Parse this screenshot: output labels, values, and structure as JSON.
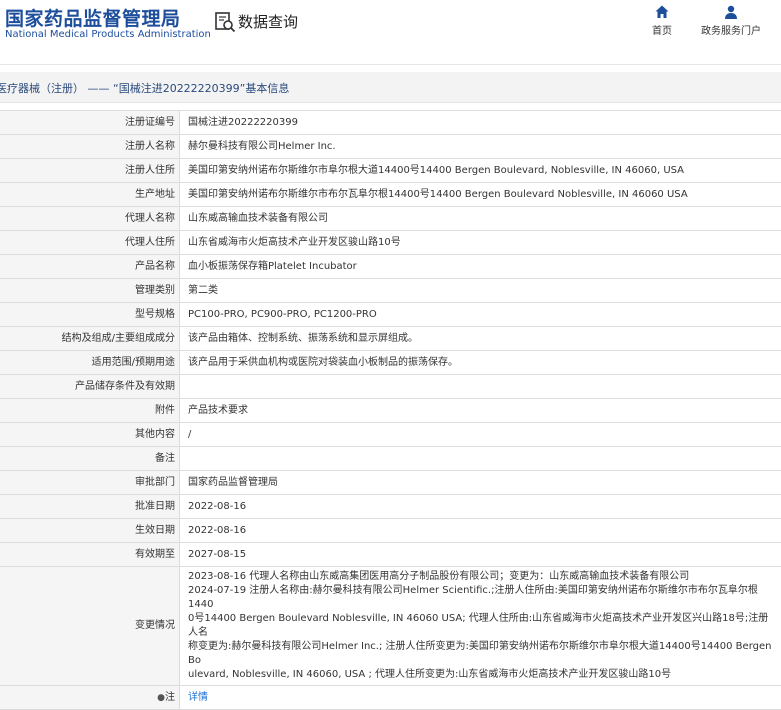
{
  "header": {
    "logo_cn": "国家药品监督管理局",
    "logo_en": "National Medical Products Administration",
    "query_title": "数据查询",
    "nav": [
      {
        "label": "首页",
        "icon": "home-icon"
      },
      {
        "label": "政务服务门户",
        "icon": "user-icon"
      }
    ]
  },
  "breadcrumb": "医疗器械（注册） —— “国械注进20222220399”基本信息",
  "rows": [
    {
      "label": "注册证编号",
      "value": "国械注进20222220399"
    },
    {
      "label": "注册人名称",
      "value": "赫尔曼科技有限公司Helmer Inc."
    },
    {
      "label": "注册人住所",
      "value": "美国印第安纳州诺布尔斯维尔市阜尔根大道14400号14400 Bergen Boulevard, Noblesville, IN 46060, USA"
    },
    {
      "label": "生产地址",
      "value": "美国印第安纳州诺布尔斯维尔市布尔瓦阜尔根14400号14400 Bergen Boulevard Noblesville, IN 46060 USA"
    },
    {
      "label": "代理人名称",
      "value": "山东威高输血技术装备有限公司"
    },
    {
      "label": "代理人住所",
      "value": "山东省威海市火炬高技术产业开发区骏山路10号"
    },
    {
      "label": "产品名称",
      "value": "血小板振荡保存箱Platelet Incubator"
    },
    {
      "label": "管理类别",
      "value": "第二类"
    },
    {
      "label": "型号规格",
      "value": "PC100-PRO, PC900-PRO, PC1200-PRO"
    },
    {
      "label": "结构及组成/主要组成成分",
      "value": "该产品由箱体、控制系统、振荡系统和显示屏组成。"
    },
    {
      "label": "适用范围/预期用途",
      "value": "该产品用于采供血机构或医院对袋装血小板制品的振荡保存。"
    },
    {
      "label": "产品储存条件及有效期",
      "value": ""
    },
    {
      "label": "附件",
      "value": "产品技术要求"
    },
    {
      "label": "其他内容",
      "value": "/"
    },
    {
      "label": "备注",
      "value": ""
    },
    {
      "label": "审批部门",
      "value": "国家药品监督管理局"
    },
    {
      "label": "批准日期",
      "value": "2022-08-16"
    },
    {
      "label": "生效日期",
      "value": "2022-08-16"
    },
    {
      "label": "有效期至",
      "value": "2027-08-15"
    }
  ],
  "change": {
    "label": "变更情况",
    "value": "2023-08-16 代理人名称由山东威高集团医用高分子制品股份有限公司；变更为：山东威高输血技术装备有限公司\n2024-07-19 注册人名称由:赫尔曼科技有限公司Helmer Scientific.;注册人住所由:美国印第安纳州诺布尔斯维尔市布尔瓦阜尔根1440\n0号14400 Bergen Boulevard Noblesville, IN 46060 USA; 代理人住所由:山东省威海市火炬高技术产业开发区兴山路18号;注册人名\n称变更为:赫尔曼科技有限公司Helmer Inc.; 注册人住所变更为:美国印第安纳州诺布尔斯维尔市阜尔根大道14400号14400 Bergen Bo\nulevard, Noblesville, IN 46060, USA ; 代理人住所变更为:山东省威海市火炬高技术产业开发区骏山路10号"
  },
  "note": {
    "label": "注",
    "link": "详情"
  }
}
